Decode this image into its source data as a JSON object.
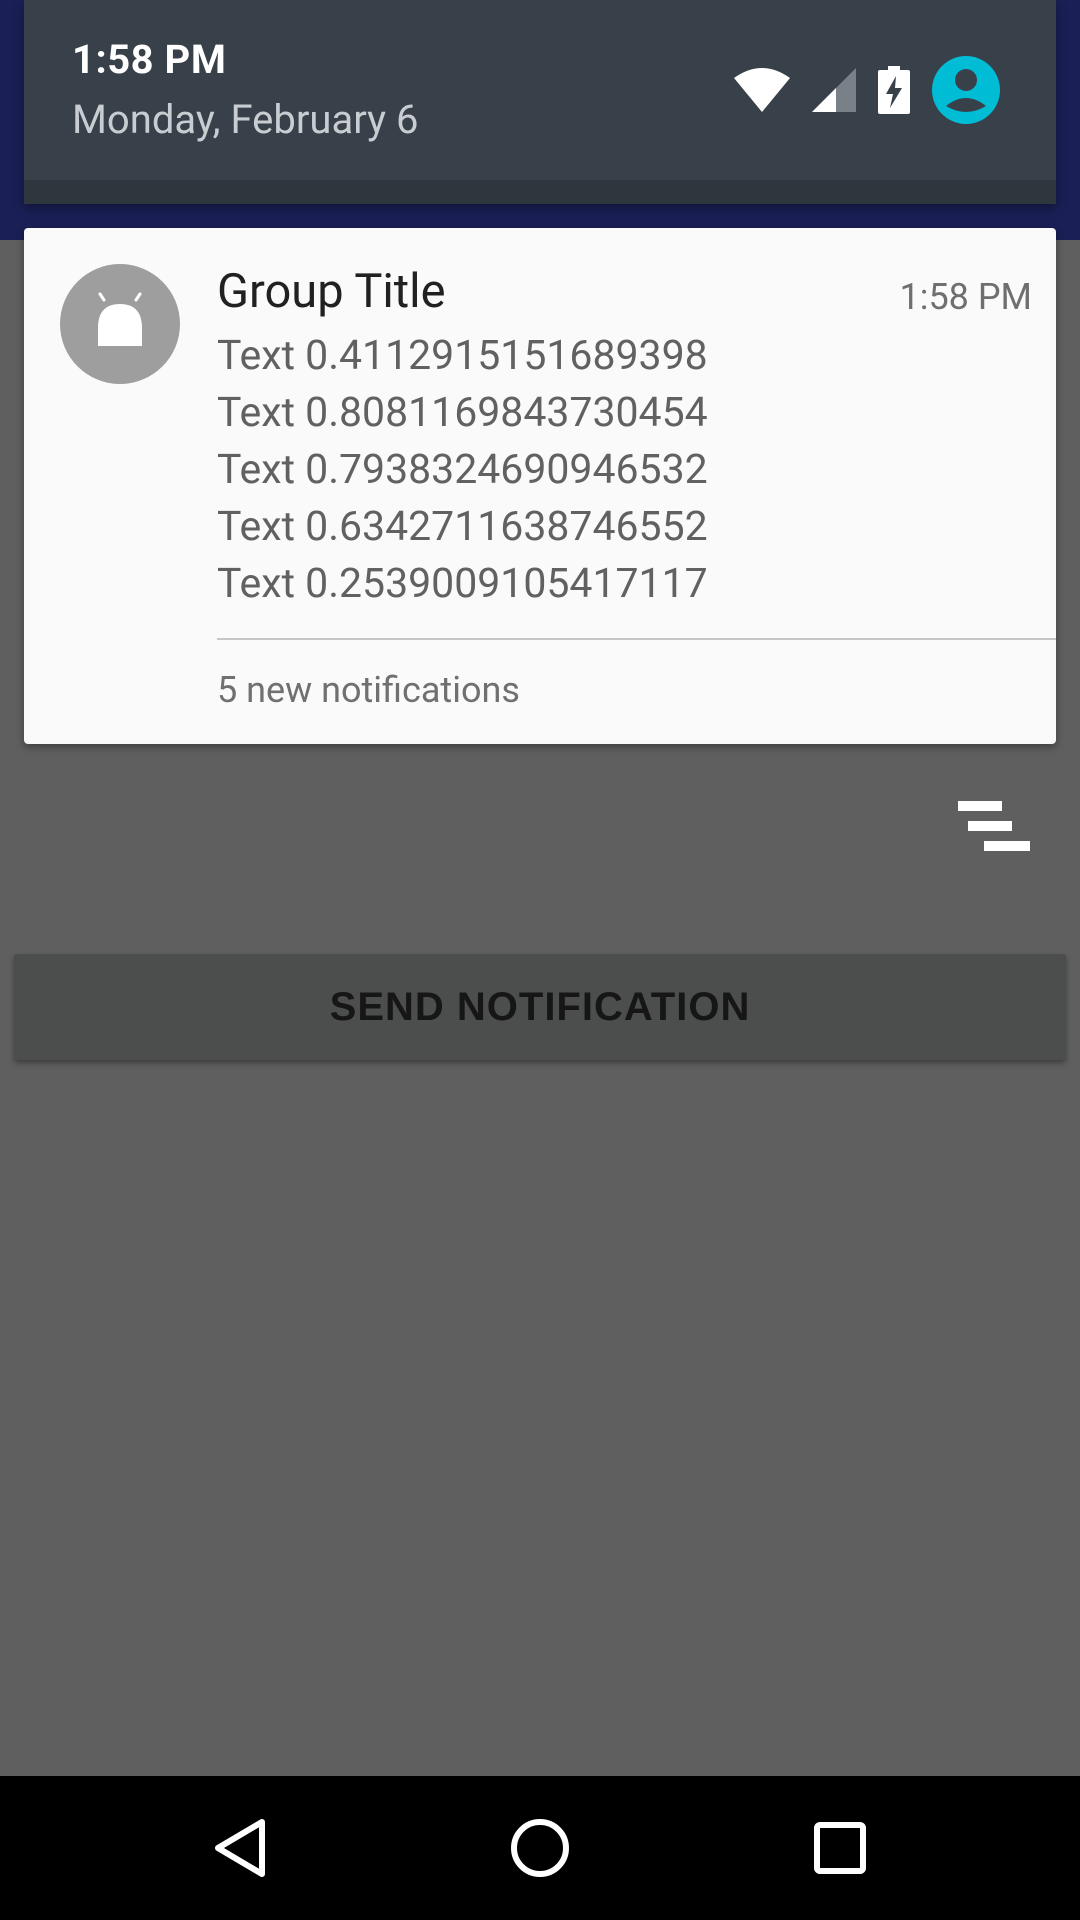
{
  "status": {
    "time": "1:58 PM",
    "date": "Monday, February 6",
    "icons": [
      "wifi-icon",
      "cell-signal-icon",
      "battery-charging-icon",
      "user-avatar-icon"
    ],
    "avatar_color": "#00bcd4"
  },
  "notification": {
    "title": "Group Title",
    "time": "1:58 PM",
    "lines": [
      "Text 0.4112915151689398",
      "Text 0.8081169843730454",
      "Text 0.7938324690946532",
      "Text 0.6342711638746552",
      "Text 0.2539009105417117"
    ],
    "summary": "5 new notifications",
    "icon": "android-icon"
  },
  "actions": {
    "clear_all_icon": "clear-all-icon",
    "send_label": "SEND NOTIFICATION"
  },
  "nav": {
    "back": "back-icon",
    "home": "home-icon",
    "recents": "recents-icon"
  }
}
